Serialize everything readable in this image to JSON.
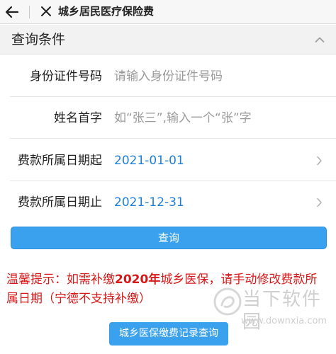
{
  "app_bar": {
    "title": "城乡居民医疗保险费",
    "back_icon": "back-arrow-icon",
    "close_icon": "close-icon"
  },
  "section": {
    "title": "查询条件",
    "toggle_icon": "chevron-up-icon"
  },
  "form": {
    "id_number": {
      "label": "身份证件号码",
      "placeholder": "请输入身份证件号码"
    },
    "name_initial": {
      "label": "姓名首字",
      "placeholder": "如“张三”,输入一个“张”字"
    },
    "date_from": {
      "label": "费款所属日期起",
      "value": "2021-01-01"
    },
    "date_to": {
      "label": "费款所属日期止",
      "value": "2021-12-31"
    }
  },
  "buttons": {
    "query": "查询",
    "record_query": "城乡医保缴费记录查询"
  },
  "tip": {
    "prefix": "温馨提示：如需补缴",
    "year": "2020年",
    "suffix": "城乡医保，请手动修改费款所属日期（宁德不支持补缴）"
  },
  "watermark": {
    "text": "当下软件园",
    "url": "www.downxia.com"
  },
  "colors": {
    "accent": "#3aa1ee",
    "value_blue": "#1e7fd9",
    "warning_red": "#d81818"
  }
}
